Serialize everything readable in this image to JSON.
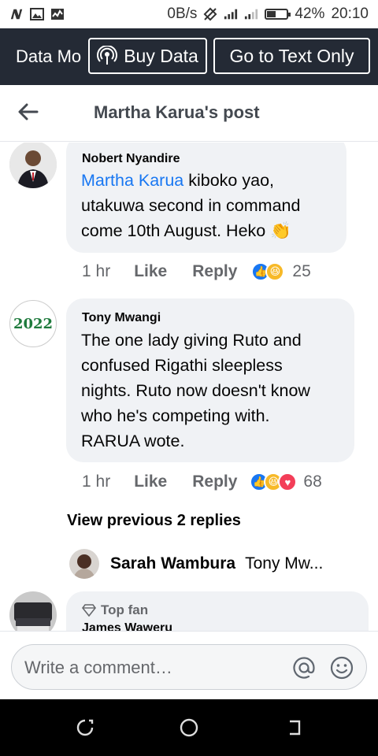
{
  "status_bar": {
    "left_icons": [
      "n-icon",
      "image-icon",
      "activity-icon"
    ],
    "net_speed": "0B/s",
    "battery": "42%",
    "battery_level": 0.42,
    "time": "20:10"
  },
  "data_bar": {
    "mode_label": "Data Mo",
    "buy_label": "Buy Data",
    "text_only_label": "Go to Text Only"
  },
  "header": {
    "title": "Martha Karua's post"
  },
  "comments": [
    {
      "author": "Nobert Nyandire",
      "mention": "Martha Karua",
      "line1_rest": " kiboko yao,",
      "line2": "utakuwa second in command",
      "line3": "come 10th August. Heko ",
      "emoji": "👏",
      "time": "1 hr",
      "like": "Like",
      "reply": "Reply",
      "reaction_count": "25"
    },
    {
      "author": "Tony Mwangi",
      "avatar_text": "2022",
      "lines": [
        "The one lady giving Ruto and",
        "confused Rigathi sleepless",
        "nights. Ruto now doesn't know",
        "who he's competing with.",
        "RARUA wote."
      ],
      "time": "1 hr",
      "like": "Like",
      "reply": "Reply",
      "reaction_count": "68"
    }
  ],
  "view_previous": "View previous 2 replies",
  "reply_preview": {
    "name": "Sarah Wambura",
    "text": "Tony Mw..."
  },
  "next_comment": {
    "badge": "Top fan",
    "author": "James Waweru"
  },
  "composer": {
    "placeholder": "Write a comment…"
  },
  "colors": {
    "data_bar": "#242a35",
    "mention": "#1877f2",
    "bubble": "#f0f2f5",
    "tony_avatar_text": "#1e7a3c"
  }
}
